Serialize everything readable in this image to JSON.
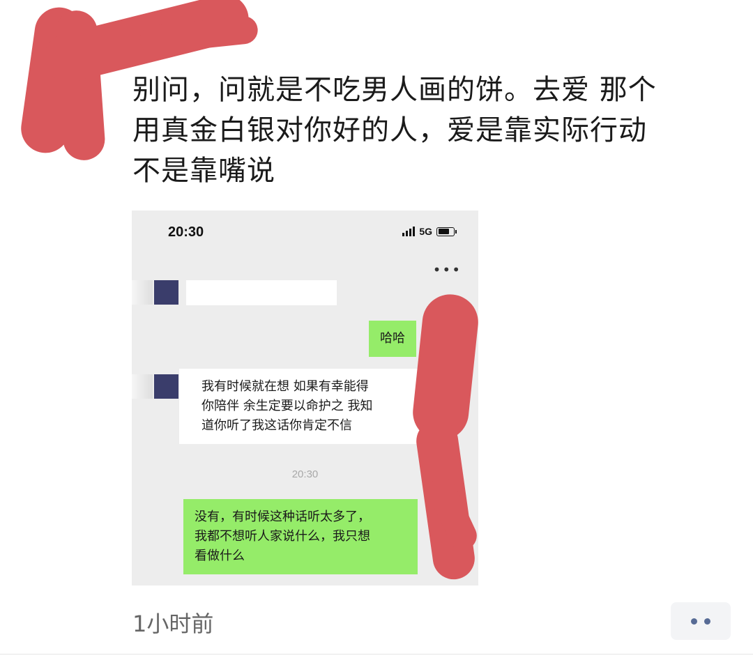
{
  "post": {
    "text_line1": "别问，问就是不吃男人画的饼。去爱 那个",
    "text_line2": "用真金白银对你好的人，爱是靠实际行动",
    "text_line3": "不是靠嘴说",
    "timestamp": "1小时前"
  },
  "screenshot": {
    "status_time": "20:30",
    "network": "5G",
    "messages": [
      {
        "side": "left",
        "text": ""
      },
      {
        "side": "right",
        "text": "哈哈"
      },
      {
        "side": "left",
        "lines": [
          "我有时候就在想  如果有幸能得",
          "你陪伴  余生定要以命护之  我知",
          "道你听了我这话你肯定不信"
        ]
      },
      {
        "side": "right",
        "lines": [
          "没有，有时候这种话听太多了，",
          "我都不想听人家说什么，我只想",
          "看做什么"
        ]
      }
    ],
    "chat_time": "20:30"
  },
  "colors": {
    "redaction": "#d9585c",
    "bubble_green": "#95ec69",
    "link_blue": "#576b95"
  },
  "icons": [
    "more-icon",
    "signal-icon",
    "battery-icon",
    "comment-dots-icon"
  ]
}
